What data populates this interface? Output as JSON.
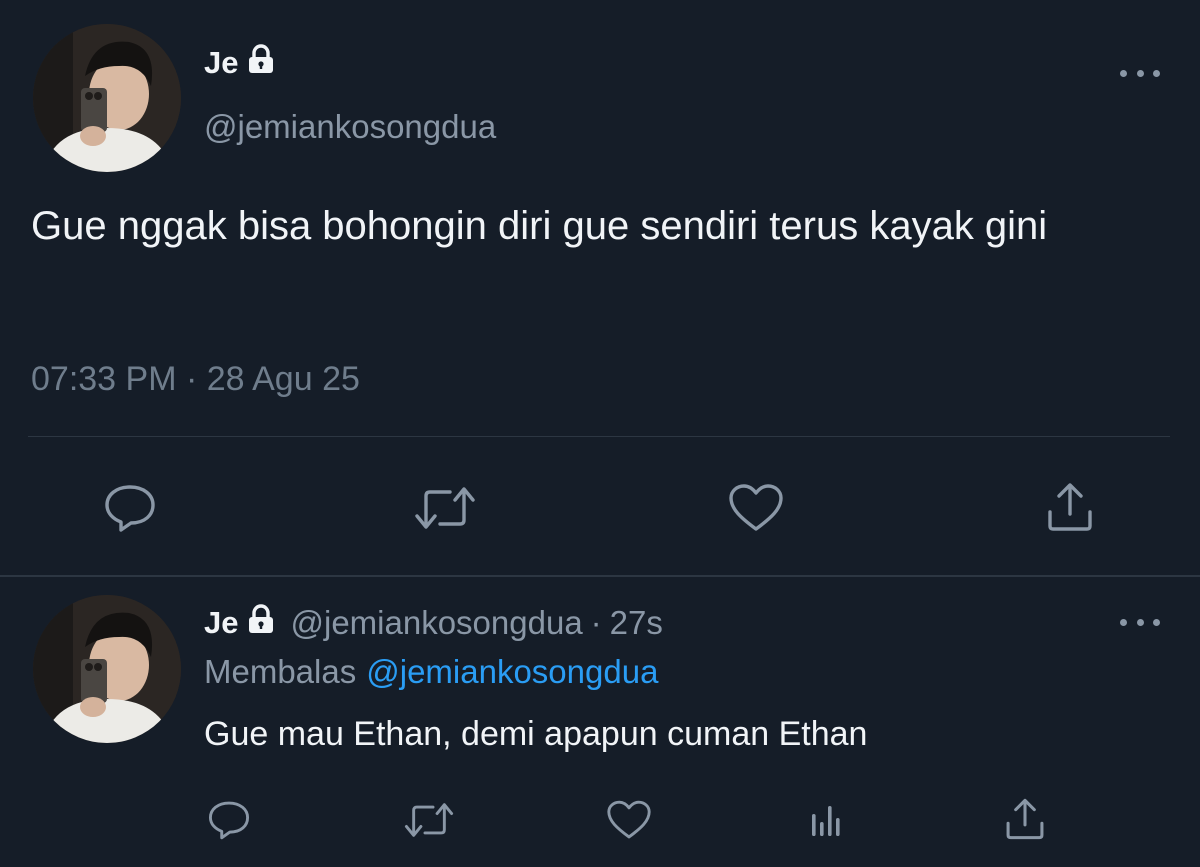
{
  "main_tweet": {
    "display_name": "Je",
    "handle": "@jemiankosongdua",
    "text": "Gue nggak bisa bohongin diri gue sendiri terus kayak gini",
    "timestamp": "07:33 PM · 28 Agu 25",
    "icons": {
      "lock": "lock-icon",
      "more": "more-icon",
      "reply": "comment-icon",
      "retweet": "retweet-icon",
      "like": "heart-icon",
      "share": "share-icon"
    }
  },
  "reply_tweet": {
    "display_name": "Je",
    "handle": "@jemiankosongdua",
    "separator": "·",
    "time_ago": "27s",
    "replying_to_label": "Membalas",
    "replying_to_handle": "@jemiankosongdua",
    "text": "Gue mau Ethan, demi apapun cuman Ethan",
    "icons": {
      "reply": "comment-icon",
      "retweet": "retweet-icon",
      "like": "heart-icon",
      "analytics": "analytics-icon",
      "share": "share-icon"
    }
  },
  "colors": {
    "background": "#151d28",
    "primary_text": "#f1f4f7",
    "secondary_text": "#8a97a6",
    "link": "#2a9df4",
    "divider": "#2c3642"
  }
}
